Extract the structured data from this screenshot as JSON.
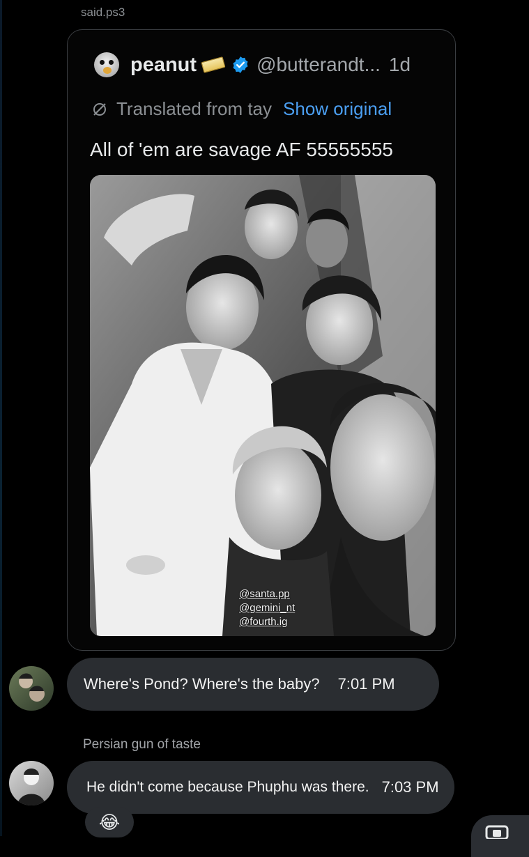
{
  "thread": {
    "sender_top": "said.ps3"
  },
  "quote": {
    "name": "peanut",
    "handle": "@butterandt...",
    "time": "1d",
    "translated_label": "Translated from tay",
    "show_original": "Show original",
    "text": "All of 'em are savage AF 55555555",
    "photo_tags": [
      "@santa.pp",
      "@gemini_nt",
      "@fourth.ig"
    ]
  },
  "messages": [
    {
      "text": "Where's Pond? Where's the baby?",
      "time": "7:01 PM"
    },
    {
      "sender": "Persian gun of taste",
      "text": "He didn't come because Phuphu was there.",
      "time": "7:03 PM",
      "reaction": "😂"
    }
  ],
  "icons": {
    "verified": "verified-badge-icon",
    "translate": "no-language-icon",
    "fab": "screen-share-icon"
  },
  "colors": {
    "link": "#4b9ff2",
    "bubble": "#2a2d31",
    "verified": "#1d9bf0"
  }
}
